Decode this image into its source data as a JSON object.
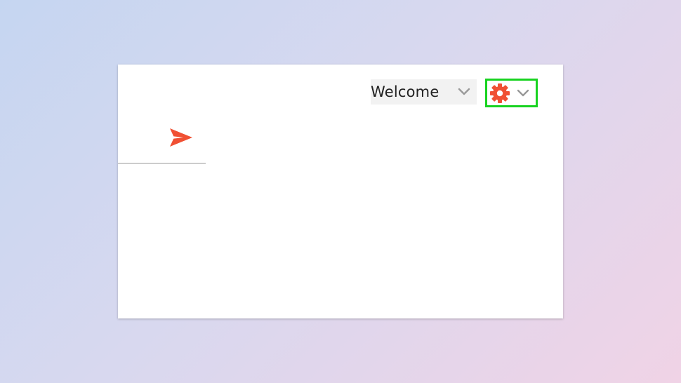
{
  "header": {
    "welcome_label": "Welcome"
  },
  "icons": {
    "welcome_chevron": "chevron-down-icon",
    "settings": "gear-icon",
    "settings_chevron": "chevron-down-icon",
    "send": "send-icon"
  },
  "colors": {
    "accent": "#f05033",
    "highlight_border": "#18d321",
    "chevron": "#999999"
  }
}
